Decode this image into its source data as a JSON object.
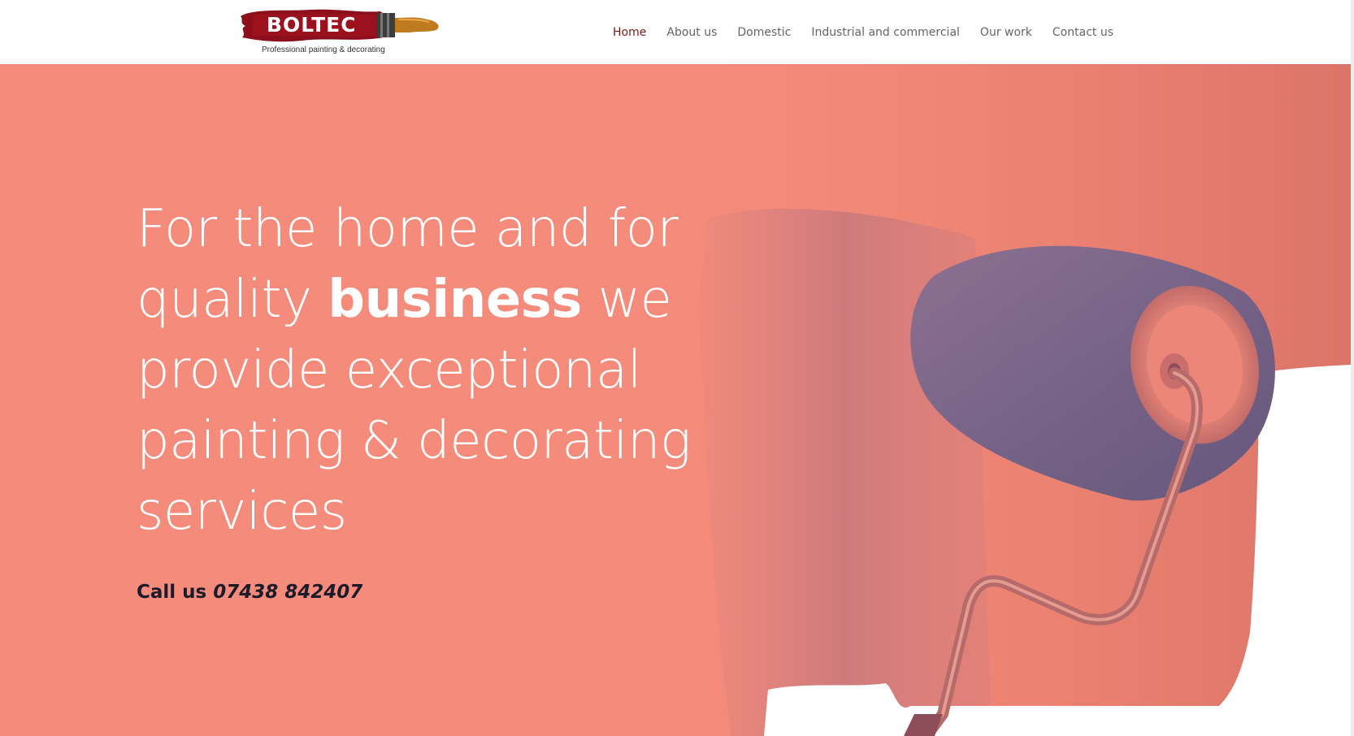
{
  "header": {
    "logo_brand": "BOLTEC",
    "logo_tagline": "Professional painting & decorating",
    "nav": [
      {
        "label": "Home",
        "active": true
      },
      {
        "label": "About us",
        "active": false
      },
      {
        "label": "Domestic",
        "active": false
      },
      {
        "label": "Industrial and commercial",
        "active": false
      },
      {
        "label": "Our work",
        "active": false
      },
      {
        "label": "Contact us",
        "active": false
      }
    ]
  },
  "hero": {
    "headline_part1": "For the home and for quality ",
    "headline_bold": "business",
    "headline_part2": " we provide exceptional painting & decorating services",
    "cta_prefix": "Call us ",
    "cta_phone": "07438 842407",
    "background_color": "#f58b7a",
    "image_icon": "paint-roller-image"
  },
  "colors": {
    "accent": "#7a1a1a",
    "nav_text": "#666666",
    "hero_text": "#ffffff",
    "cta_text": "#1b1b2b"
  }
}
